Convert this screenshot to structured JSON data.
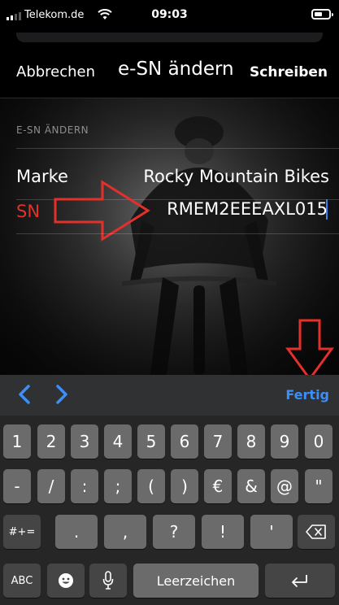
{
  "status_bar": {
    "carrier": "Telekom.de",
    "time": "09:03"
  },
  "nav": {
    "cancel": "Abbrechen",
    "title": "e-SN ändern",
    "save": "Schreiben"
  },
  "form": {
    "section_header": "E-SN ÄNDERN",
    "brand_label": "Marke",
    "brand_value": "Rocky Mountain Bikes",
    "sn_label": "SN",
    "sn_value": "RMEM2EEEAXL015"
  },
  "accessory_bar": {
    "done": "Fertig"
  },
  "keyboard": {
    "row1": [
      "1",
      "2",
      "3",
      "4",
      "5",
      "6",
      "7",
      "8",
      "9",
      "0"
    ],
    "row2": [
      "-",
      "/",
      ":",
      ";",
      "(",
      ")",
      "€",
      "&",
      "@",
      "\""
    ],
    "row3": {
      "shift": "#+=",
      "keys": [
        ".",
        ",",
        "?",
        "!",
        "'"
      ]
    },
    "row4": {
      "abc": "ABC",
      "space": "Leerzeichen"
    }
  },
  "colors": {
    "accent_red": "#e3302b",
    "link_blue": "#3d8ef7",
    "caret_blue": "#3b82f6"
  }
}
